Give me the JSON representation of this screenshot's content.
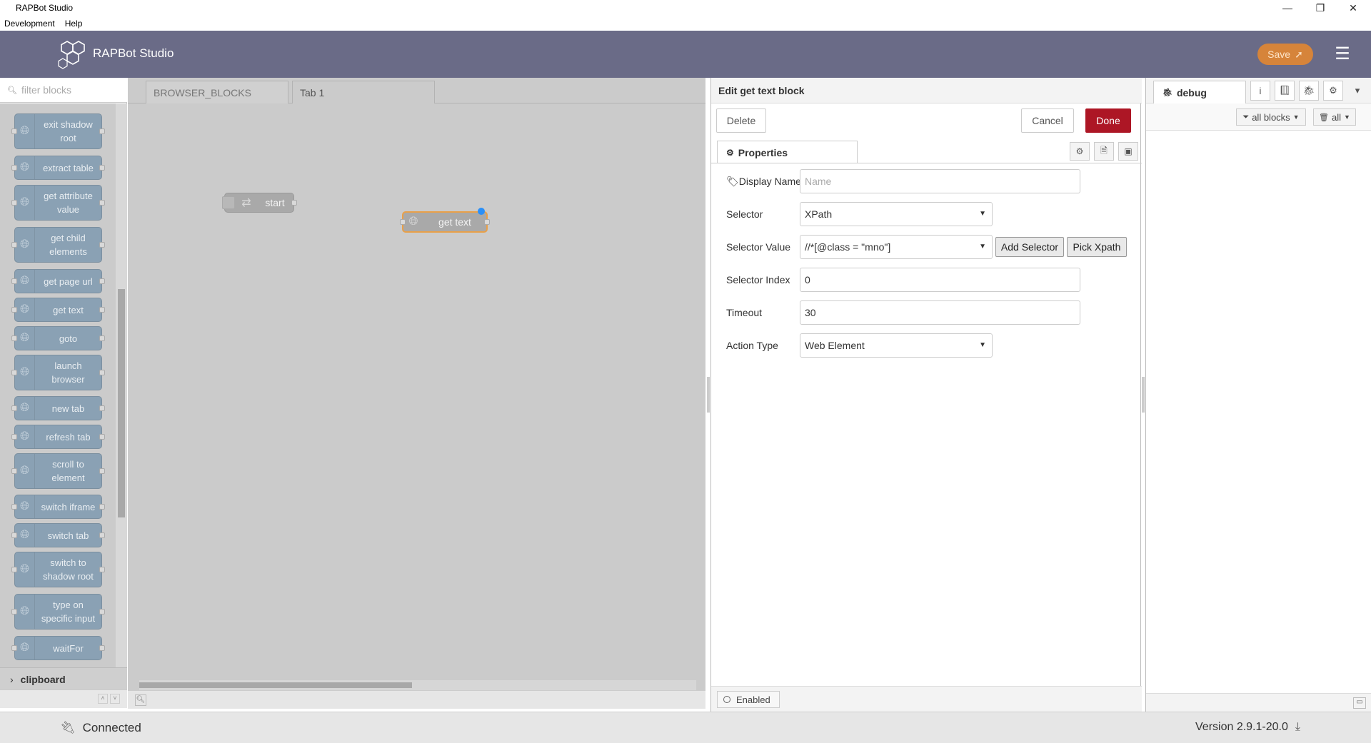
{
  "window": {
    "title": "RAPBot Studio",
    "minimize": "—",
    "maximize": "❐",
    "close": "✕"
  },
  "menu": [
    "Development",
    "Help"
  ],
  "header": {
    "brand": "RAPBot Studio",
    "save_label": "Save",
    "hamburger": "☰"
  },
  "palette": {
    "filter_placeholder": "filter blocks",
    "blocks": [
      "exit shadow root",
      "extract table",
      "get attribute value",
      "get child elements",
      "get page url",
      "get text",
      "goto",
      "launch browser",
      "new tab",
      "refresh tab",
      "scroll to element",
      "switch iframe",
      "switch tab",
      "switch to shadow root",
      "type on specific input",
      "waitFor"
    ],
    "category": "clipboard"
  },
  "workspace": {
    "tabs": [
      "BROWSER_BLOCKS",
      "Tab 1"
    ],
    "nodes": [
      {
        "label": "start"
      },
      {
        "label": "get text"
      }
    ]
  },
  "editor": {
    "title": "Edit get text block",
    "delete_label": "Delete",
    "cancel_label": "Cancel",
    "done_label": "Done",
    "properties_tab": "Properties",
    "fields": {
      "display_name_label": "Display Name",
      "display_name_placeholder": "Name",
      "selector_label": "Selector",
      "selector_value": "XPath",
      "selector_value_label": "Selector Value",
      "selector_value_value": "//*[@class = \"mno\"]",
      "add_selector": "Add Selector",
      "pick_xpath": "Pick Xpath",
      "selector_index_label": "Selector Index",
      "selector_index_value": "0",
      "timeout_label": "Timeout",
      "timeout_value": "30",
      "action_type_label": "Action Type",
      "action_type_value": "Web Element"
    },
    "enabled_label": "Enabled"
  },
  "sidebar": {
    "tab": "debug",
    "filter_all_blocks": "all blocks",
    "clear_all": "all"
  },
  "status": {
    "connection": "Connected",
    "version": "Version 2.9.1-20.0"
  }
}
